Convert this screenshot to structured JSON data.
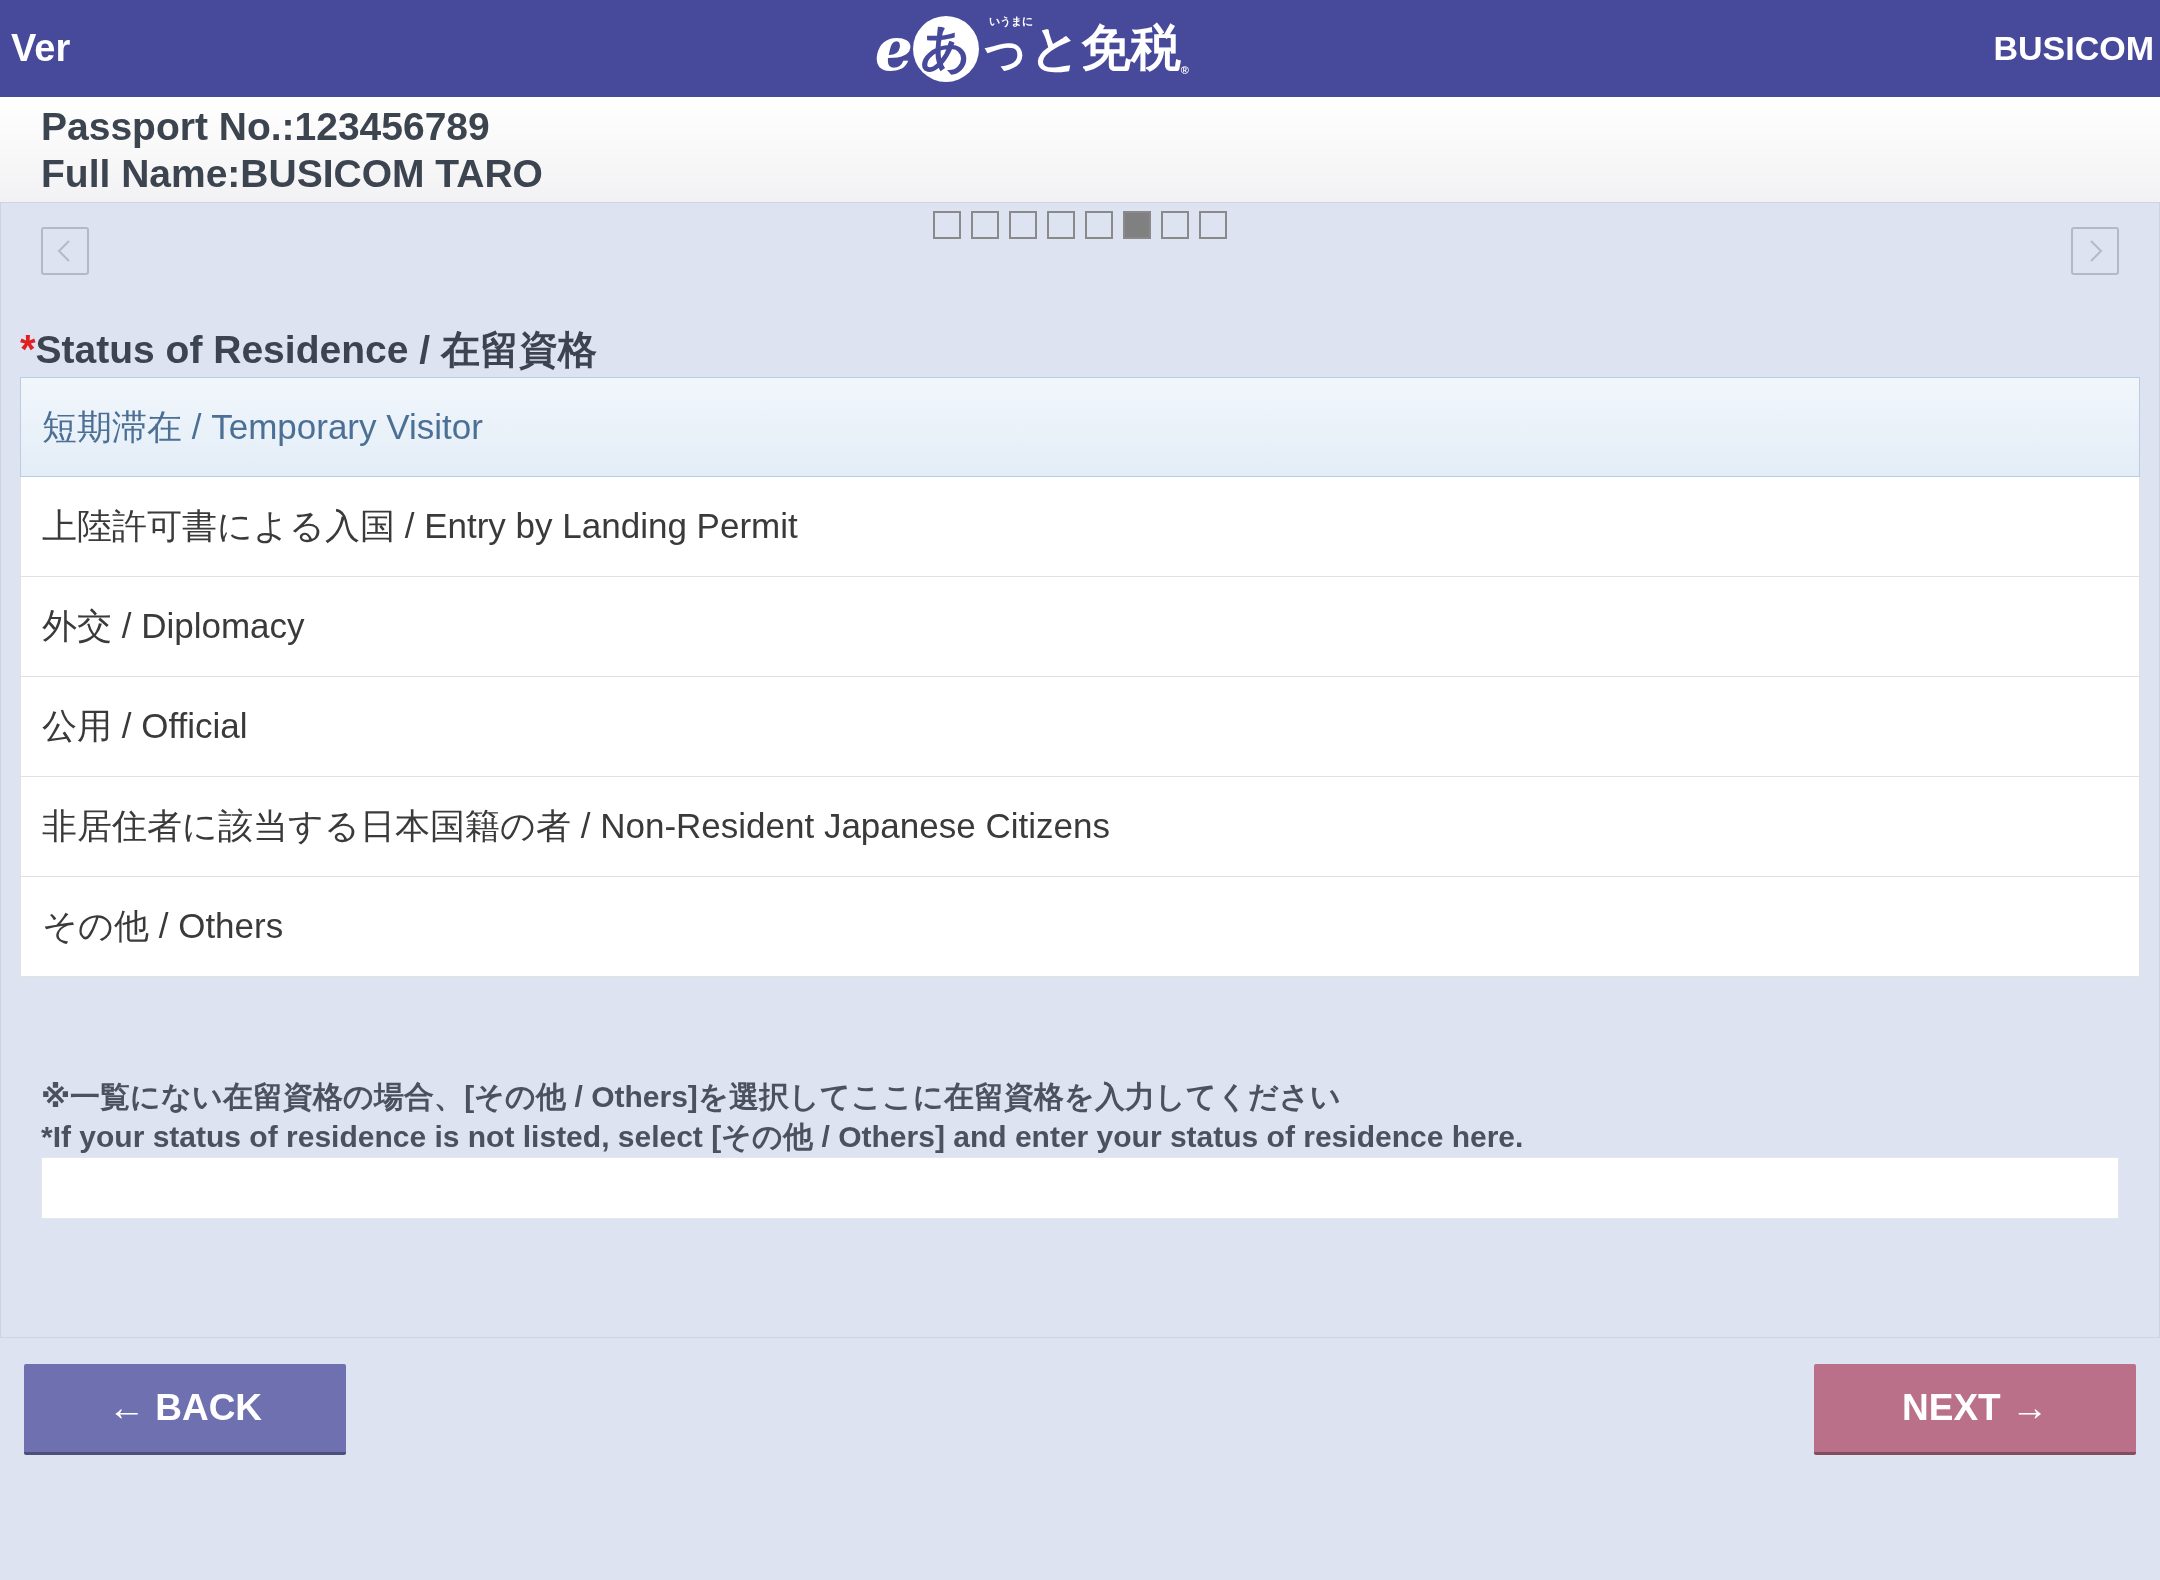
{
  "header": {
    "left": "Ver",
    "logo": {
      "e": "e",
      "circle": "あ",
      "rest": "っと免税",
      "ruby": "いうまに",
      "mark": "®"
    },
    "right": "BUSICOM"
  },
  "info": [
    "Passport No.:123456789",
    "Full Name:BUSICOM TARO"
  ],
  "pager": [
    {
      "selected": false
    },
    {
      "selected": false
    },
    {
      "selected": false
    },
    {
      "selected": false
    },
    {
      "selected": false
    },
    {
      "selected": true
    },
    {
      "selected": false
    },
    {
      "selected": false
    }
  ],
  "question": {
    "required_mark": "*",
    "title": "Status of Residence / 在留資格"
  },
  "options": [
    {
      "label": "短期滞在 / Temporary Visitor",
      "selected": true
    },
    {
      "label": "上陸許可書による入国 / Entry by Landing Permit",
      "selected": false
    },
    {
      "label": "外交 / Diplomacy",
      "selected": false
    },
    {
      "label": "公用 / Official",
      "selected": false
    },
    {
      "label": "非居住者に該当する日本国籍の者 / Non-Resident Japanese Citizens",
      "selected": false
    },
    {
      "label": "その他 / Others",
      "selected": false
    }
  ],
  "notes": [
    "※一覧にない在留資格の場合、[その他 / Others]を選択してここに在留資格を入力してください",
    "*If your status of residence is not listed, select [その他 / Others] and enter your status of residence here."
  ],
  "buttons": [
    {
      "kind": "back",
      "label": "← BACK"
    },
    {
      "kind": "next",
      "label": "NEXT →"
    }
  ]
}
